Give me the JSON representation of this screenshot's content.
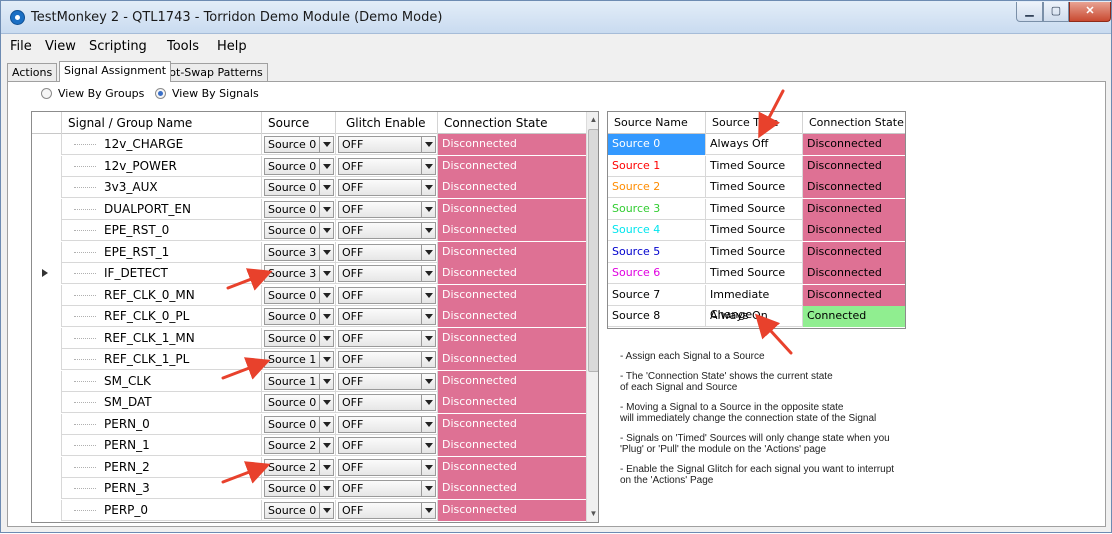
{
  "window": {
    "title": "TestMonkey 2 - QTL1743 - Torridon Demo Module (Demo Mode)"
  },
  "menu": [
    "File",
    "View",
    "Scripting",
    "Tools",
    "Help"
  ],
  "tabs": [
    "Actions",
    "Signal Assignment",
    "Hot-Swap Patterns"
  ],
  "view_options": {
    "groups": "View By Groups",
    "signals": "View By Signals",
    "selected": "signals"
  },
  "signals_grid": {
    "headers": [
      "Signal / Group Name",
      "Source",
      "Glitch Enable",
      "Connection State"
    ],
    "rows": [
      {
        "name": "12v_CHARGE",
        "source": "Source 0",
        "glitch": "OFF",
        "state": "Disconnected"
      },
      {
        "name": "12v_POWER",
        "source": "Source 0",
        "glitch": "OFF",
        "state": "Disconnected"
      },
      {
        "name": "3v3_AUX",
        "source": "Source 0",
        "glitch": "OFF",
        "state": "Disconnected"
      },
      {
        "name": "DUALPORT_EN",
        "source": "Source 0",
        "glitch": "OFF",
        "state": "Disconnected"
      },
      {
        "name": "EPE_RST_0",
        "source": "Source 0",
        "glitch": "OFF",
        "state": "Disconnected"
      },
      {
        "name": "EPE_RST_1",
        "source": "Source 3",
        "glitch": "OFF",
        "state": "Disconnected"
      },
      {
        "name": "IF_DETECT",
        "source": "Source 3",
        "glitch": "OFF",
        "state": "Disconnected"
      },
      {
        "name": "REF_CLK_0_MN",
        "source": "Source 0",
        "glitch": "OFF",
        "state": "Disconnected"
      },
      {
        "name": "REF_CLK_0_PL",
        "source": "Source 0",
        "glitch": "OFF",
        "state": "Disconnected"
      },
      {
        "name": "REF_CLK_1_MN",
        "source": "Source 0",
        "glitch": "OFF",
        "state": "Disconnected"
      },
      {
        "name": "REF_CLK_1_PL",
        "source": "Source 1",
        "glitch": "OFF",
        "state": "Disconnected"
      },
      {
        "name": "SM_CLK",
        "source": "Source 1",
        "glitch": "OFF",
        "state": "Disconnected"
      },
      {
        "name": "SM_DAT",
        "source": "Source 0",
        "glitch": "OFF",
        "state": "Disconnected"
      },
      {
        "name": "PERN_0",
        "source": "Source 0",
        "glitch": "OFF",
        "state": "Disconnected"
      },
      {
        "name": "PERN_1",
        "source": "Source 2",
        "glitch": "OFF",
        "state": "Disconnected"
      },
      {
        "name": "PERN_2",
        "source": "Source 2",
        "glitch": "OFF",
        "state": "Disconnected"
      },
      {
        "name": "PERN_3",
        "source": "Source 0",
        "glitch": "OFF",
        "state": "Disconnected"
      },
      {
        "name": "PERP_0",
        "source": "Source 0",
        "glitch": "OFF",
        "state": "Disconnected"
      }
    ]
  },
  "sources_grid": {
    "headers": [
      "Source Name",
      "Source Type",
      "Connection State"
    ],
    "rows": [
      {
        "name": "Source 0",
        "type": "Always Off",
        "state": "Disconnected",
        "color": "#ffffff",
        "selected": true
      },
      {
        "name": "Source 1",
        "type": "Timed Source",
        "state": "Disconnected",
        "color": "#ff0000"
      },
      {
        "name": "Source 2",
        "type": "Timed Source",
        "state": "Disconnected",
        "color": "#ff8c00"
      },
      {
        "name": "Source 3",
        "type": "Timed Source",
        "state": "Disconnected",
        "color": "#32cd32"
      },
      {
        "name": "Source 4",
        "type": "Timed Source",
        "state": "Disconnected",
        "color": "#00e5ee"
      },
      {
        "name": "Source 5",
        "type": "Timed Source",
        "state": "Disconnected",
        "color": "#0000cd"
      },
      {
        "name": "Source 6",
        "type": "Timed Source",
        "state": "Disconnected",
        "color": "#e000e0"
      },
      {
        "name": "Source 7",
        "type": "Immediate Change",
        "state": "Disconnected",
        "color": "#000000"
      },
      {
        "name": "Source 8",
        "type": "Always On",
        "state": "Connected",
        "color": "#000000"
      }
    ]
  },
  "notes": [
    "- Assign each Signal to a Source",
    "- The 'Connection State' shows the current state\n  of each Signal and Source",
    "- Moving a Signal to a Source in the opposite state\n  will immediately change the connection state of the Signal",
    "- Signals on 'Timed' Sources will only change state when you\n  'Plug' or 'Pull' the module on the 'Actions' page",
    "- Enable the Signal Glitch for each signal you want to interrupt\n  on the 'Actions' Page"
  ],
  "colors": {
    "disconnected": "#de7194",
    "connected": "#90ee90",
    "selection": "#3399ff",
    "annotation_arrow": "#e8412c"
  }
}
